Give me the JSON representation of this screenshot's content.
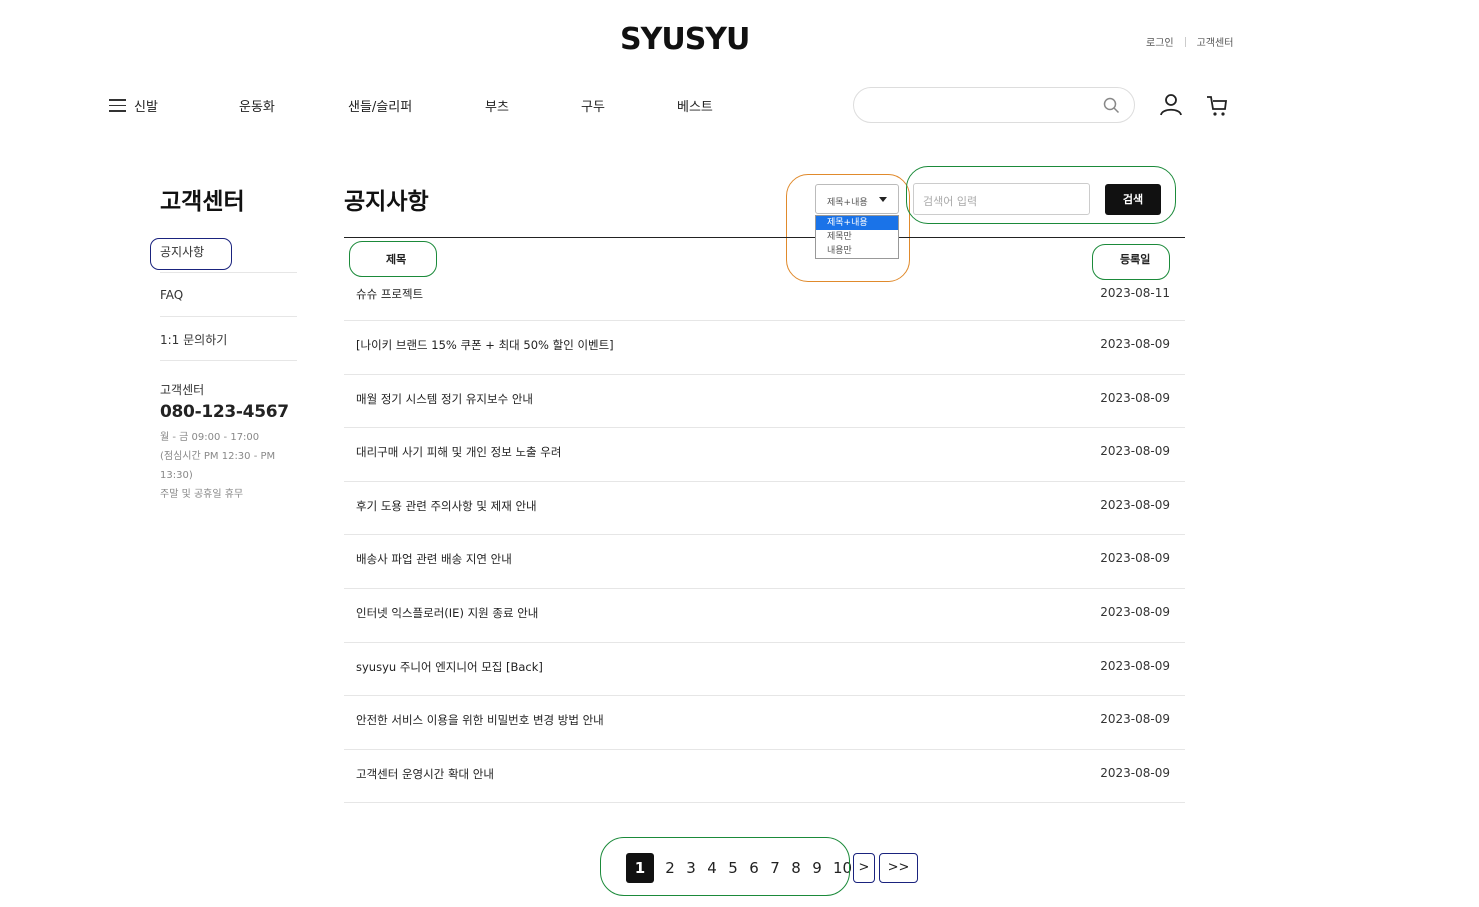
{
  "header": {
    "logo": "SYUSYU",
    "util_links": [
      "로그인",
      "고객센터"
    ]
  },
  "gnb": {
    "items": [
      "신발",
      "운동화",
      "샌들/슬리퍼",
      "부츠",
      "구두",
      "베스트"
    ]
  },
  "icons": {
    "menu": "hamburger-icon",
    "search": "search-icon",
    "user": "user-icon",
    "cart": "cart-icon"
  },
  "sidebar": {
    "title": "고객센터",
    "menu": [
      "공지사항",
      "FAQ",
      "1:1 문의하기"
    ],
    "cs_label": "고객센터",
    "cs_phone": "080-123-4567",
    "cs_hours": [
      "월 - 금 09:00 - 17:00",
      "(점심시간 PM 12:30 - PM",
      "13:30)",
      "주말 및 공휴일 휴무"
    ]
  },
  "main": {
    "title": "공지사항",
    "search": {
      "select_value": "제목+내용",
      "options": [
        "제목+내용",
        "제목만",
        "내용만"
      ],
      "placeholder": "검색어 입력",
      "button": "검색"
    },
    "columns": [
      "제목",
      "등록일"
    ],
    "rows": [
      {
        "title": "슈슈 프로젝트",
        "date": "2023-08-11"
      },
      {
        "title": "[나이키 브랜드 15% 쿠폰 + 최대 50% 할인 이벤트]",
        "date": "2023-08-09"
      },
      {
        "title": "매월 정기 시스템 정기 유지보수 안내",
        "date": "2023-08-09"
      },
      {
        "title": "대리구매 사기 피해 및 개인 정보 노출 우려",
        "date": "2023-08-09"
      },
      {
        "title": "후기 도용 관련 주의사항 및 제재 안내",
        "date": "2023-08-09"
      },
      {
        "title": "배송사 파업 관련 배송 지연 안내",
        "date": "2023-08-09"
      },
      {
        "title": "인터넷 익스플로러(IE) 지원 종료 안내",
        "date": "2023-08-09"
      },
      {
        "title": "syusyu 주니어 엔지니어 모집 [Back]",
        "date": "2023-08-09"
      },
      {
        "title": "안전한 서비스 이용을 위한 비밀번호 변경 방법 안내",
        "date": "2023-08-09"
      },
      {
        "title": "고객센터 운영시간 확대 안내",
        "date": "2023-08-09"
      }
    ]
  },
  "pagination": {
    "pages": [
      "1",
      "2",
      "3",
      "4",
      "5",
      "6",
      "7",
      "8",
      "9",
      "10"
    ],
    "next": ">",
    "last": ">>",
    "current": "1"
  },
  "colors": {
    "annotation_green": "#1b8a3a",
    "annotation_orange": "#e08a2c",
    "annotation_navy": "#1a237e",
    "select_highlight": "#1a73e8"
  }
}
